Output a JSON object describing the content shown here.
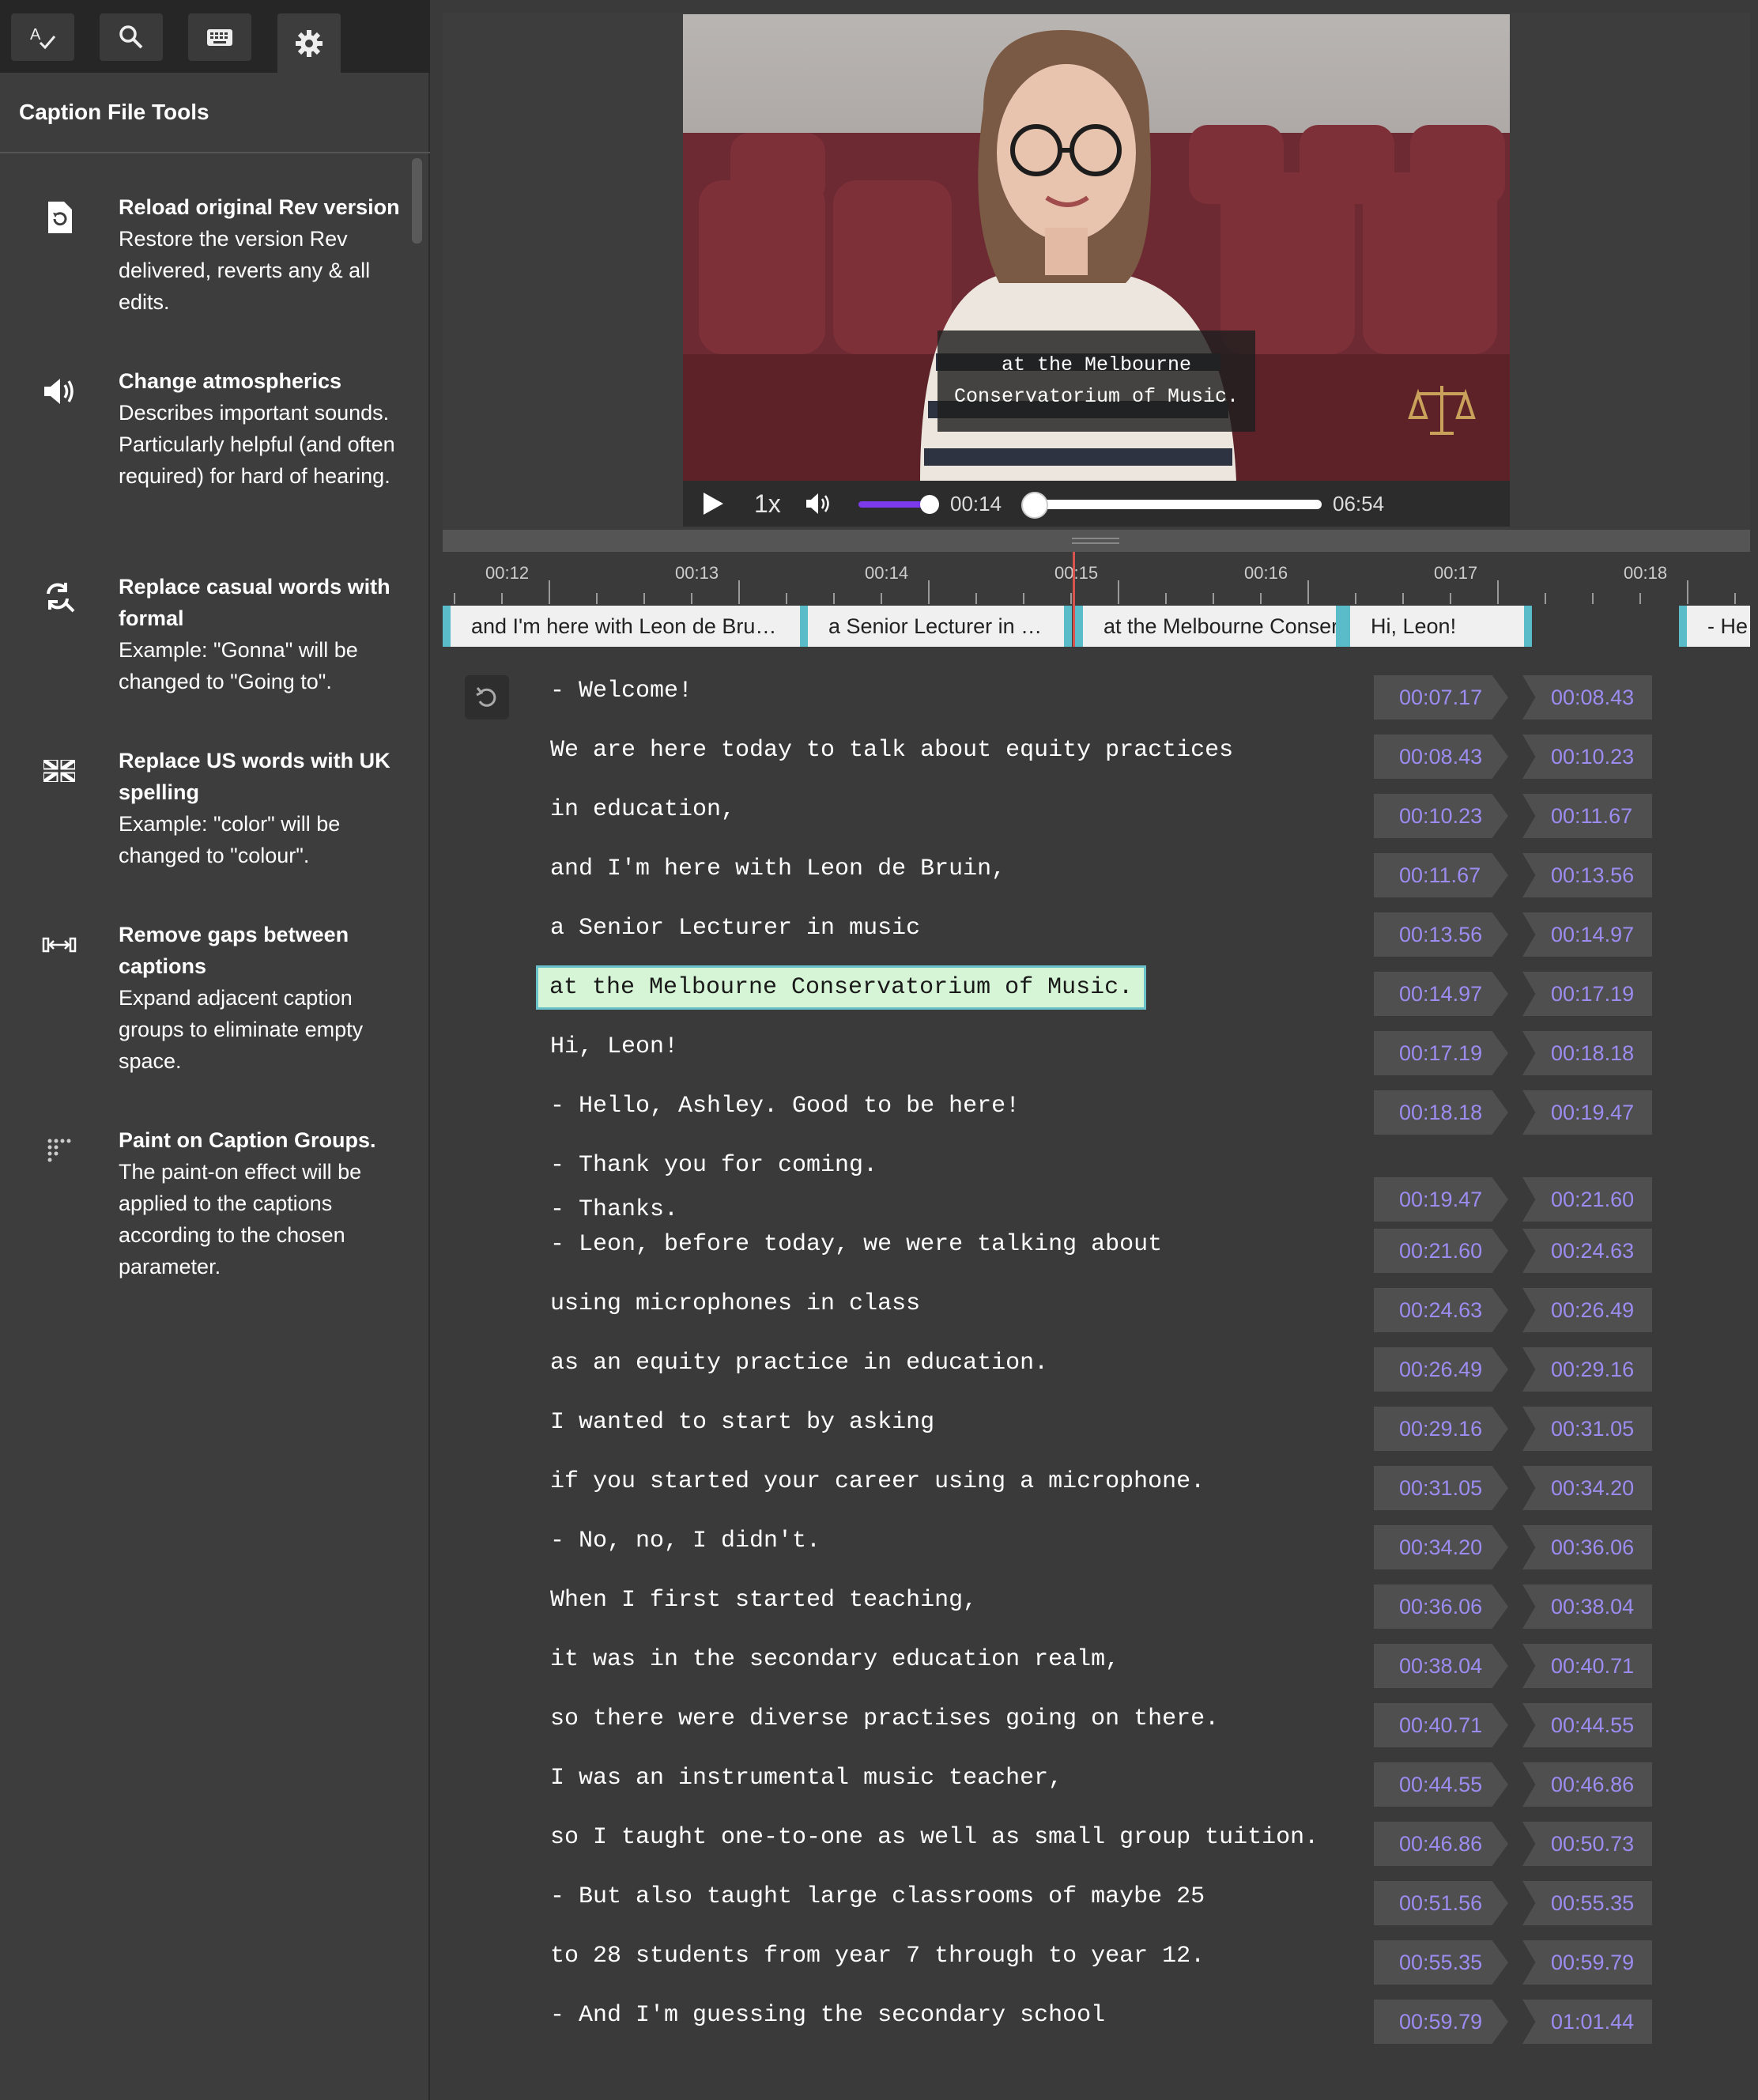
{
  "sidebar": {
    "tabs": [
      {
        "icon": "spellcheck-icon"
      },
      {
        "icon": "search-icon"
      },
      {
        "icon": "keyboard-icon"
      },
      {
        "icon": "gear-icon"
      }
    ],
    "title": "Caption File Tools",
    "tools": [
      {
        "icon": "reload-document-icon",
        "name": "Reload original Rev version",
        "desc": "Restore the version Rev delivered, reverts any & all edits."
      },
      {
        "icon": "speaker-icon",
        "name": "Change atmospherics",
        "desc": "Describes important sounds. Particularly helpful (and often required) for hard of hearing."
      },
      {
        "icon": "find-replace-icon",
        "name": "Replace casual words with formal",
        "desc": "Example: \"Gonna\" will be changed to \"Going to\"."
      },
      {
        "icon": "uk-flag-icon",
        "name": "Replace US words with UK spelling",
        "desc": "Example: \"color\" will be changed to \"colour\"."
      },
      {
        "icon": "expand-gaps-icon",
        "name": "Remove gaps between captions",
        "desc": "Expand adjacent caption groups to eliminate empty space."
      },
      {
        "icon": "paint-dots-icon",
        "name": "Paint on Caption Groups.",
        "desc": "The paint-on effect will be applied to the captions according to the chosen parameter."
      }
    ]
  },
  "player": {
    "overlay_caption": "at the Melbourne\nConservatorium of Music.",
    "speed": "1x",
    "current_time": "00:14",
    "duration": "06:54",
    "volume_level": 0.9,
    "progress_fraction": 0.035
  },
  "timeline": {
    "ticks": [
      "00:12",
      "00:13",
      "00:14",
      "00:15",
      "00:16",
      "00:17",
      "00:18"
    ],
    "segments": [
      "and I'm here with Leon de Bru…",
      "a Senior Lecturer in …",
      "at the Melbourne Conservatorium of…",
      "Hi, Leon!",
      "- He"
    ]
  },
  "captions": [
    {
      "text": "- Welcome!",
      "start": "00:07.17",
      "end": "00:08.43"
    },
    {
      "text": "We are here today to talk about equity practices",
      "start": "00:08.43",
      "end": "00:10.23"
    },
    {
      "text": "in education,",
      "start": "00:10.23",
      "end": "00:11.67"
    },
    {
      "text": "and I'm here with Leon de Bruin,",
      "start": "00:11.67",
      "end": "00:13.56"
    },
    {
      "text": "a Senior Lecturer in music",
      "start": "00:13.56",
      "end": "00:14.97"
    },
    {
      "text": "at the Melbourne Conservatorium of Music.",
      "start": "00:14.97",
      "end": "00:17.19"
    },
    {
      "text": "Hi, Leon!",
      "start": "00:17.19",
      "end": "00:18.18"
    },
    {
      "text": "- Hello, Ashley. Good to be here!",
      "start": "00:18.18",
      "end": "00:19.47"
    },
    {
      "text": "- Thank you for coming.\n- Thanks.",
      "start": "00:19.47",
      "end": "00:21.60"
    },
    {
      "text": "- Leon, before today, we were talking about",
      "start": "00:21.60",
      "end": "00:24.63"
    },
    {
      "text": "using microphones in class",
      "start": "00:24.63",
      "end": "00:26.49"
    },
    {
      "text": "as an equity practice in education.",
      "start": "00:26.49",
      "end": "00:29.16"
    },
    {
      "text": "I wanted to start by asking",
      "start": "00:29.16",
      "end": "00:31.05"
    },
    {
      "text": "if you started your career using a microphone.",
      "start": "00:31.05",
      "end": "00:34.20"
    },
    {
      "text": "- No, no, I didn't.",
      "start": "00:34.20",
      "end": "00:36.06"
    },
    {
      "text": "When I first started teaching,",
      "start": "00:36.06",
      "end": "00:38.04"
    },
    {
      "text": "it was in the secondary education realm,",
      "start": "00:38.04",
      "end": "00:40.71"
    },
    {
      "text": "so there were diverse practises going on there.",
      "start": "00:40.71",
      "end": "00:44.55"
    },
    {
      "text": "I was an instrumental music teacher,",
      "start": "00:44.55",
      "end": "00:46.86"
    },
    {
      "text": "so I taught one-to-one as well as small group tuition.",
      "start": "00:46.86",
      "end": "00:50.73"
    },
    {
      "text": "- But also taught large classrooms of maybe 25",
      "start": "00:51.56",
      "end": "00:55.35"
    },
    {
      "text": "to 28 students from year 7 through to year 12.",
      "start": "00:55.35",
      "end": "00:59.79"
    },
    {
      "text": "- And I'm guessing the secondary school",
      "start": "00:59.79",
      "end": "01:01.44"
    }
  ],
  "colors": {
    "accent": "#7c3aed",
    "timestamp": "#9b8cf0",
    "selected_bg": "#d6f5d6",
    "segment_edge": "#5bbcc9",
    "playhead": "#d9534f"
  }
}
